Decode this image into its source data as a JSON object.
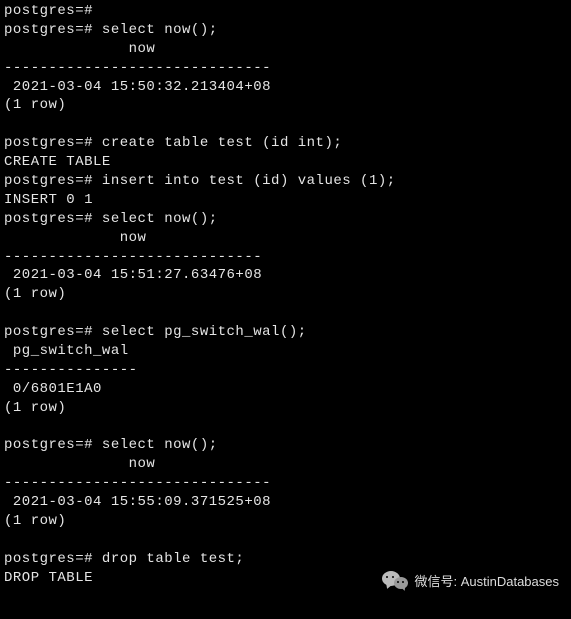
{
  "terminal": {
    "lines": [
      "postgres=#",
      "postgres=# select now();",
      "              now",
      "------------------------------",
      " 2021-03-04 15:50:32.213404+08",
      "(1 row)",
      "",
      "postgres=# create table test (id int);",
      "CREATE TABLE",
      "postgres=# insert into test (id) values (1);",
      "INSERT 0 1",
      "postgres=# select now();",
      "             now",
      "-----------------------------",
      " 2021-03-04 15:51:27.63476+08",
      "(1 row)",
      "",
      "postgres=# select pg_switch_wal();",
      " pg_switch_wal",
      "---------------",
      " 0/6801E1A0",
      "(1 row)",
      "",
      "postgres=# select now();",
      "              now",
      "------------------------------",
      " 2021-03-04 15:55:09.371525+08",
      "(1 row)",
      "",
      "postgres=# drop table test;",
      "DROP TABLE"
    ]
  },
  "watermark": {
    "label": "微信号",
    "separator": ":",
    "account": "AustinDatabases"
  }
}
